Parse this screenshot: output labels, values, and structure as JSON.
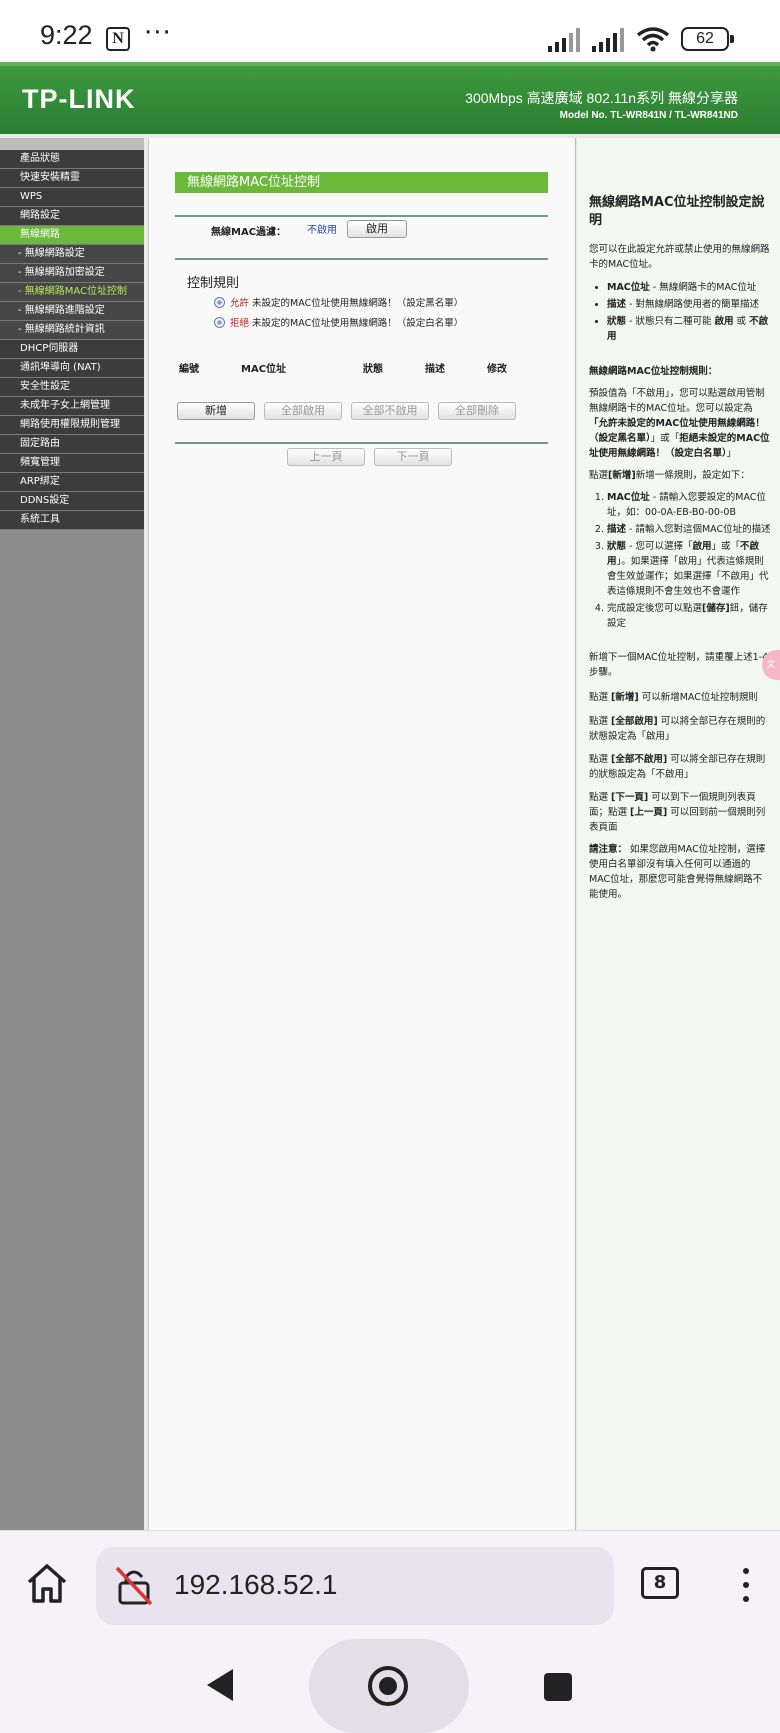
{
  "status_bar": {
    "time": "9:22",
    "notion_letter": "N",
    "more": "···",
    "battery": "62"
  },
  "header": {
    "logo": "TP-LINK",
    "title": "300Mbps 高速廣域 802.11n系列 無線分享器",
    "model": "Model No. TL-WR841N / TL-WR841ND"
  },
  "sidebar": {
    "items": [
      {
        "label": "產品狀態"
      },
      {
        "label": "快速安裝精靈"
      },
      {
        "label": "WPS"
      },
      {
        "label": "網路設定"
      },
      {
        "label": "無線網路"
      },
      {
        "label": "- 無線網路設定"
      },
      {
        "label": "- 無線網路加密設定"
      },
      {
        "label": "- 無線網路MAC位址控制"
      },
      {
        "label": "- 無線網路進階設定"
      },
      {
        "label": "- 無線網路統計資訊"
      },
      {
        "label": "DHCP伺服器"
      },
      {
        "label": "通訊埠導向 (NAT)"
      },
      {
        "label": "安全性設定"
      },
      {
        "label": "未成年子女上網管理"
      },
      {
        "label": "網路使用權限規則管理"
      },
      {
        "label": "固定路由"
      },
      {
        "label": "頻寬管理"
      },
      {
        "label": "ARP綁定"
      },
      {
        "label": "DDNS設定"
      },
      {
        "label": "系統工具"
      }
    ]
  },
  "main": {
    "section_title": "無線網路MAC位址控制",
    "filter_label": "無線MAC過濾：",
    "filter_value": "不啟用",
    "enable_button": "啟用",
    "rules_title": "控制規則",
    "allow_word": "允許",
    "allow_text": " 未設定的MAC位址使用無線網路！（設定黑名單）",
    "deny_word": "拒絕",
    "deny_text": " 未設定的MAC位址使用無線網路！（設定白名單）",
    "table_headers": [
      "編號",
      "MAC位址",
      "狀態",
      "描述",
      "修改"
    ],
    "buttons": {
      "add": "新增",
      "enable_all": "全部啟用",
      "disable_all": "全部不啟用",
      "delete_all": "全部刪除"
    },
    "pager": {
      "prev": "上一頁",
      "next": "下一頁"
    }
  },
  "help": {
    "title": "無線網路MAC位址控制設定說明",
    "intro": "您可以在此設定允許或禁止使用的無線網路卡的MAC位址。",
    "bullets": [
      {
        "term": "MAC位址",
        "desc": " - 無線網路卡的MAC位址"
      },
      {
        "term": "描述",
        "desc": " - 對無線網路使用者的簡單描述"
      },
      {
        "term": "狀態",
        "desc": " - 狀態只有二種可能 ",
        "b1": "啟用",
        "mid": " 或 ",
        "b2": "不啟用"
      }
    ],
    "rules_heading": "無線網路MAC位址控制規則：",
    "rules_p1": "預設值為「不啟用」，您可以點選啟用管制無線網路卡的MAC位址。您可以設定為",
    "rules_b1": "「允許未設定的MAC位址使用無線網路！（設定黑名單）",
    "rules_or": "」或「",
    "rules_b2": "拒絕未設定的MAC位址使用無線網路！（設定白名單）",
    "rules_end": "」",
    "add_intro_a": "點選",
    "add_intro_b": "[新增]",
    "add_intro_c": "新增一條規則，設定如下：",
    "steps": [
      {
        "term": "MAC位址",
        "desc": " - 請輸入您要設定的MAC位址，如：00-0A-EB-B0-00-0B"
      },
      {
        "term": "描述",
        "desc": " - 請輸入您對這個MAC位址的描述"
      },
      {
        "term": "狀態",
        "desc": " - 您可以選擇「",
        "b1": "啟用",
        "mid": "」或「",
        "b2": "不啟用",
        "tail": "」。如果選擇「啟用」代表這條規則會生效並運作；如果選擇「不啟用」代表這條規則不會生效也不會運作"
      },
      {
        "term": "",
        "desc": "完成設定後您可以點選",
        "b1": "[儲存]",
        "tail": "鈕，儲存設定"
      }
    ],
    "repeat": "新增下一個MAC位址控制，請重覆上述1-4步驟。",
    "p_add_a": "點選 ",
    "p_add_b": "[新增]",
    "p_add_c": " 可以新增MAC位址控制規則",
    "p_en_a": "點選 ",
    "p_en_b": "[全部啟用]",
    "p_en_c": " 可以將全部已存在規則的狀態設定為「啟用」",
    "p_dis_a": "點選 ",
    "p_dis_b": "[全部不啟用]",
    "p_dis_c": " 可以將全部已存在規則的狀態設定為「不啟用」",
    "p_next_a": "點選 ",
    "p_next_b": "[下一頁]",
    "p_next_c": " 可以到下一個規則列表頁面；點選 ",
    "p_next_d": "[上一頁]",
    "p_next_e": " 可以回到前一個規則列表頁面",
    "note_b": "請注意：",
    "note": " 如果您啟用MAC位址控制，選擇使用白名單卻沒有填入任何可以通過的MAC位址，那麼您可能會覺得無線網路不能使用。"
  },
  "browser": {
    "url": "192.168.52.1",
    "tab_count": "8"
  }
}
